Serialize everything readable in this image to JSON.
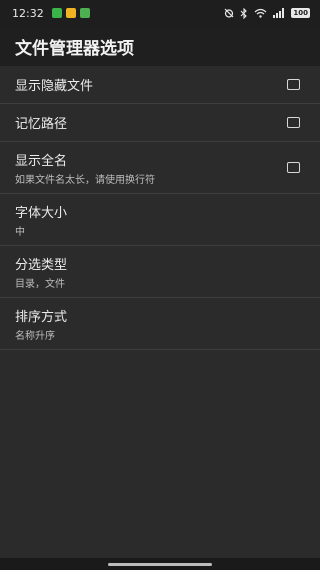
{
  "status_bar": {
    "time": "12:32",
    "battery": "100"
  },
  "toolbar": {
    "title": "文件管理器选项"
  },
  "settings": [
    {
      "label": "显示隐藏文件",
      "type": "checkbox",
      "checked": false
    },
    {
      "label": "记忆路径",
      "type": "checkbox",
      "checked": false
    },
    {
      "label": "显示全名",
      "summary": "如果文件名太长，请使用换行符",
      "type": "checkbox",
      "checked": false
    },
    {
      "label": "字体大小",
      "summary": "中",
      "type": "choice"
    },
    {
      "label": "分选类型",
      "summary": "目录，文件",
      "type": "choice"
    },
    {
      "label": "排序方式",
      "summary": "名称升序",
      "type": "choice"
    }
  ],
  "colors": {
    "background": "#2b2b2b",
    "toolbar": "#1f1f1f",
    "text": "#ececec",
    "divider": "#3e3e3e"
  }
}
